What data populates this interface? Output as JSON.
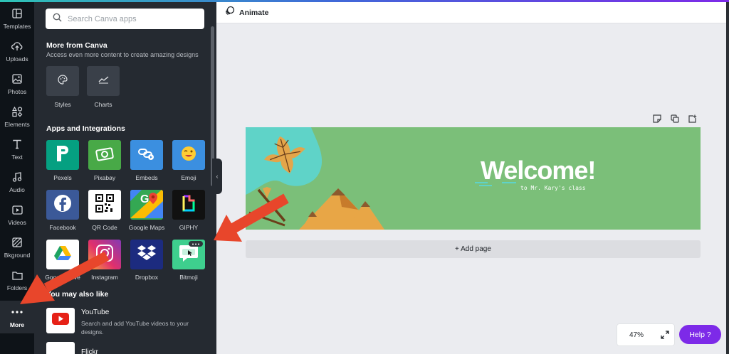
{
  "rail": {
    "items": [
      {
        "label": "Templates",
        "icon": "templates-icon"
      },
      {
        "label": "Uploads",
        "icon": "upload-cloud-icon"
      },
      {
        "label": "Photos",
        "icon": "image-icon"
      },
      {
        "label": "Elements",
        "icon": "shapes-icon"
      },
      {
        "label": "Text",
        "icon": "text-icon"
      },
      {
        "label": "Audio",
        "icon": "music-note-icon"
      },
      {
        "label": "Videos",
        "icon": "video-icon"
      },
      {
        "label": "Bkground",
        "icon": "background-icon"
      },
      {
        "label": "Folders",
        "icon": "folder-icon"
      },
      {
        "label": "More",
        "icon": "more-dots-icon",
        "active": true
      }
    ]
  },
  "panel": {
    "search_placeholder": "Search Canva apps",
    "more_from_canva": {
      "title": "More from Canva",
      "subtitle": "Access even more content to create amazing designs",
      "items": [
        {
          "label": "Styles",
          "icon": "palette-icon"
        },
        {
          "label": "Charts",
          "icon": "line-chart-icon"
        }
      ]
    },
    "apps": {
      "title": "Apps and Integrations",
      "items": [
        {
          "label": "Pexels",
          "icon": "pexels-icon",
          "color": "#05a081"
        },
        {
          "label": "Pixabay",
          "icon": "pixabay-icon",
          "color": "#48a947"
        },
        {
          "label": "Embeds",
          "icon": "embeds-icon",
          "color": "#3b8fe0"
        },
        {
          "label": "Emoji",
          "icon": "emoji-icon",
          "color": "#3b8fe0"
        },
        {
          "label": "Facebook",
          "icon": "facebook-icon",
          "color": "#3b5998"
        },
        {
          "label": "QR Code",
          "icon": "qr-code-icon",
          "color": "#ffffff"
        },
        {
          "label": "Google Maps",
          "icon": "google-maps-icon",
          "color": "#34a853"
        },
        {
          "label": "GIPHY",
          "icon": "giphy-icon",
          "color": "#111111"
        },
        {
          "label": "Google Drive",
          "icon": "google-drive-icon",
          "color": "#ffffff"
        },
        {
          "label": "Instagram",
          "icon": "instagram-icon",
          "color": "#c13584"
        },
        {
          "label": "Dropbox",
          "icon": "dropbox-icon",
          "color": "#1c2b7f"
        },
        {
          "label": "Bitmoji",
          "icon": "bitmoji-icon",
          "color": "#3ecf8e"
        }
      ]
    },
    "also_like": {
      "title": "You may also like",
      "items": [
        {
          "title": "YouTube",
          "desc": "Search and add YouTube videos to your designs.",
          "icon": "youtube-icon"
        },
        {
          "title": "Flickr",
          "icon": "flickr-icon"
        }
      ]
    }
  },
  "header": {
    "animate_label": "Animate"
  },
  "canvas": {
    "title": "Welcome!",
    "subtitle": "to Mr. Kary's class",
    "background_color": "#7bbf79"
  },
  "add_page_label": "+ Add page",
  "zoom": {
    "value": "47%"
  },
  "help_label": "Help ?",
  "annotation_arrow_color": "#e8462b"
}
